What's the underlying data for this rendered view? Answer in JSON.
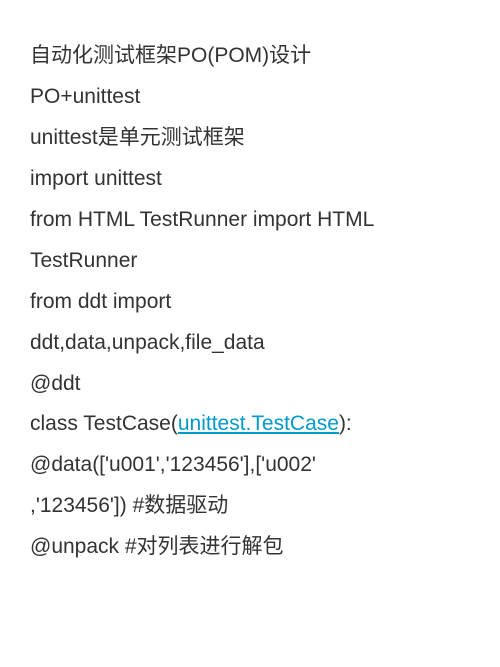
{
  "lines": {
    "l1": "自动化测试框架PO(POM)设计",
    "l2": "PO+unittest",
    "l3": "unittest是单元测试框架",
    "l4": "import unittest",
    "l5a": "from HTML TestRunner import HTML",
    "l5b": "TestRunner",
    "l6": "from ddt import",
    "l7": "ddt,data,unpack,file_data",
    "l8": "@ddt",
    "l9_pre": "class TestCase(",
    "l9_link": "unittest.TestCase",
    "l9_post": "):",
    "l10a": "@data(['u001','123456'],['u002'",
    "l10b": ",'123456']) #数据驱动",
    "l11": "@unpack  #对列表进行解包"
  },
  "link_color": "#0099cc"
}
